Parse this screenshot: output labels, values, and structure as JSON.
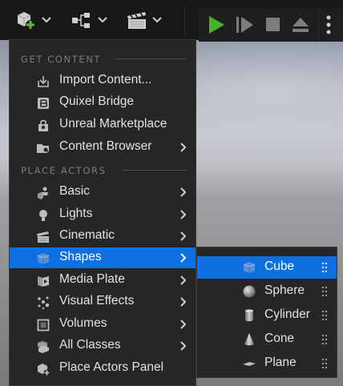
{
  "menu": {
    "sections": [
      {
        "header": "GET CONTENT",
        "items": [
          {
            "label": "Import Content...",
            "icon": "import-icon",
            "submenu": false
          },
          {
            "label": "Quixel Bridge",
            "icon": "bridge-icon",
            "submenu": false
          },
          {
            "label": "Unreal Marketplace",
            "icon": "marketplace-icon",
            "submenu": false
          },
          {
            "label": "Content Browser",
            "icon": "folder-icon",
            "submenu": true
          }
        ]
      },
      {
        "header": "PLACE ACTORS",
        "items": [
          {
            "label": "Basic",
            "icon": "basic-actors-icon",
            "submenu": true
          },
          {
            "label": "Lights",
            "icon": "lightbulb-icon",
            "submenu": true
          },
          {
            "label": "Cinematic",
            "icon": "clapperboard-icon",
            "submenu": true
          },
          {
            "label": "Shapes",
            "icon": "cube-icon",
            "submenu": true,
            "selected": true
          },
          {
            "label": "Media Plate",
            "icon": "media-plate-icon",
            "submenu": true
          },
          {
            "label": "Visual Effects",
            "icon": "sparkles-icon",
            "submenu": true
          },
          {
            "label": "Volumes",
            "icon": "volume-icon",
            "submenu": true
          },
          {
            "label": "All Classes",
            "icon": "all-classes-icon",
            "submenu": true
          },
          {
            "label": "Place Actors Panel",
            "icon": "place-actors-icon",
            "submenu": false
          }
        ]
      }
    ]
  },
  "shapes_submenu": {
    "items": [
      {
        "label": "Cube",
        "icon": "cube-icon",
        "selected": true
      },
      {
        "label": "Sphere",
        "icon": "sphere-icon"
      },
      {
        "label": "Cylinder",
        "icon": "cylinder-icon"
      },
      {
        "label": "Cone",
        "icon": "cone-icon"
      },
      {
        "label": "Plane",
        "icon": "plane-icon"
      }
    ]
  },
  "colors": {
    "selection": "#0e70e0",
    "play_green": "#4bb12a",
    "add_green": "#5fbb2c"
  }
}
